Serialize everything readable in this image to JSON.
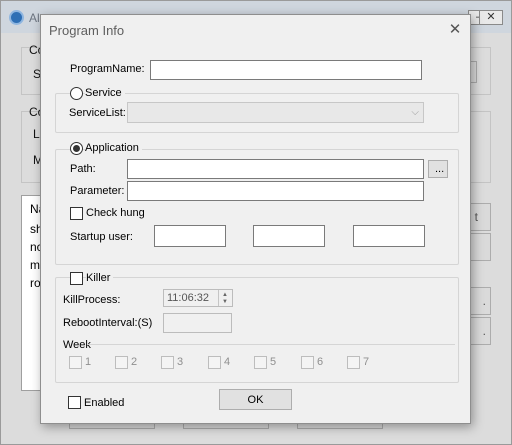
{
  "background": {
    "title": "Al",
    "labels": [
      "Co",
      "S",
      "Co",
      "L",
      "M"
    ],
    "list_items": [
      "Na",
      "sh",
      "nc",
      "m",
      "ro"
    ],
    "side_button_texts": [
      "t",
      ".",
      "."
    ]
  },
  "dialog": {
    "title": "Program Info",
    "close_glyph": "✕",
    "program_name": {
      "label": "ProgramName:",
      "value": ""
    },
    "service": {
      "radio_label": "Service",
      "selected": false,
      "service_list_label": "ServiceList:",
      "service_list_value": ""
    },
    "application": {
      "radio_label": "Application",
      "selected": true,
      "path_label": "Path:",
      "path_value": "",
      "browse_label": "...",
      "parameter_label": "Parameter:",
      "parameter_value": "",
      "check_hung_label": "Check hung",
      "check_hung_checked": false,
      "startup_user_label": "Startup user:",
      "startup_user_fields": [
        "",
        "",
        ""
      ]
    },
    "killer": {
      "checkbox_label": "Killer",
      "checked": false,
      "kill_process_label": "KillProcess:",
      "kill_process_value": "11:06:32",
      "reboot_interval_label": "RebootInterval:(S)",
      "reboot_interval_value": "",
      "week_label": "Week",
      "days": [
        "1",
        "2",
        "3",
        "4",
        "5",
        "6",
        "7"
      ]
    },
    "enabled_label": "Enabled",
    "enabled_checked": false,
    "ok_label": "OK"
  }
}
